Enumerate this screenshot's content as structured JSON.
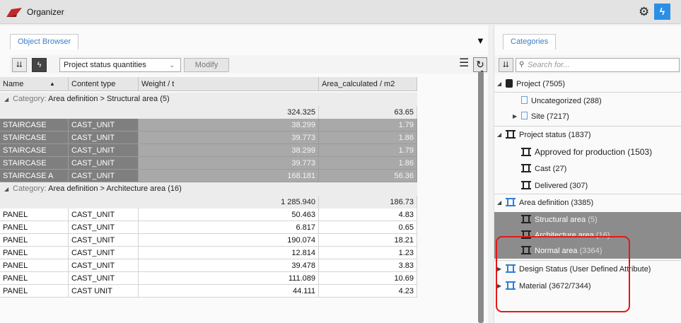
{
  "app": {
    "title": "Organizer"
  },
  "left": {
    "tab": "Object Browser",
    "toolbar": {
      "selected_query": "Project status quantities",
      "modify_label": "Modify"
    },
    "columns": [
      "Name",
      "Content type",
      "Weight / t",
      "Area_calculated / m2"
    ],
    "groups": [
      {
        "label_prefix": "Category:",
        "label": "Area definition > Structural area (5)",
        "sum_weight": "324.325",
        "sum_area": "63.65",
        "rows": [
          {
            "name": "STAIRCASE",
            "type": "CAST_UNIT",
            "weight": "38.299",
            "area": "1.79"
          },
          {
            "name": "STAIRCASE",
            "type": "CAST_UNIT",
            "weight": "39.773",
            "area": "1.86"
          },
          {
            "name": "STAIRCASE",
            "type": "CAST_UNIT",
            "weight": "38.299",
            "area": "1.79"
          },
          {
            "name": "STAIRCASE",
            "type": "CAST_UNIT",
            "weight": "39.773",
            "area": "1.86"
          },
          {
            "name": "STAIRCASE A",
            "type": "CAST_UNIT",
            "weight": "168.181",
            "area": "56.36"
          }
        ]
      },
      {
        "label_prefix": "Category:",
        "label": "Area definition > Architecture area (16)",
        "sum_weight": "1 285.940",
        "sum_area": "186.73",
        "rows": [
          {
            "name": "PANEL",
            "type": "CAST_UNIT",
            "weight": "50.463",
            "area": "4.83"
          },
          {
            "name": "PANEL",
            "type": "CAST_UNIT",
            "weight": "6.817",
            "area": "0.65"
          },
          {
            "name": "PANEL",
            "type": "CAST_UNIT",
            "weight": "190.074",
            "area": "18.21"
          },
          {
            "name": "PANEL",
            "type": "CAST_UNIT",
            "weight": "12.814",
            "area": "1.23"
          },
          {
            "name": "PANEL",
            "type": "CAST_UNIT",
            "weight": "39.478",
            "area": "3.83"
          },
          {
            "name": "PANEL",
            "type": "CAST_UNIT",
            "weight": "111.089",
            "area": "10.69"
          },
          {
            "name": "PANEL",
            "type": "CAST UNIT",
            "weight": "44.111",
            "area": "4.23"
          }
        ]
      }
    ]
  },
  "right": {
    "tab": "Categories",
    "search_placeholder": "Search for...",
    "tree": {
      "project": "Project (7505)",
      "uncategorized": "Uncategorized (288)",
      "site": "Site (7217)",
      "project_status": "Project status (1837)",
      "approved": "Approved for production (1503)",
      "cast": "Cast (27)",
      "delivered": "Delivered (307)",
      "area_definition": "Area definition (3385)",
      "structural_name": "Structural area",
      "structural_count": "(5)",
      "architecture_name": "Architecture area",
      "architecture_count": "(16)",
      "normal_name": "Normal area",
      "normal_count": "(3364)",
      "design_status": "Design Status (User Defined Attribute)",
      "material": "Material (3672/7344)"
    }
  },
  "colors": {
    "accent": "#2b8fe5",
    "selection": "#7f7f7f",
    "highlight_ring": "#e31818"
  }
}
